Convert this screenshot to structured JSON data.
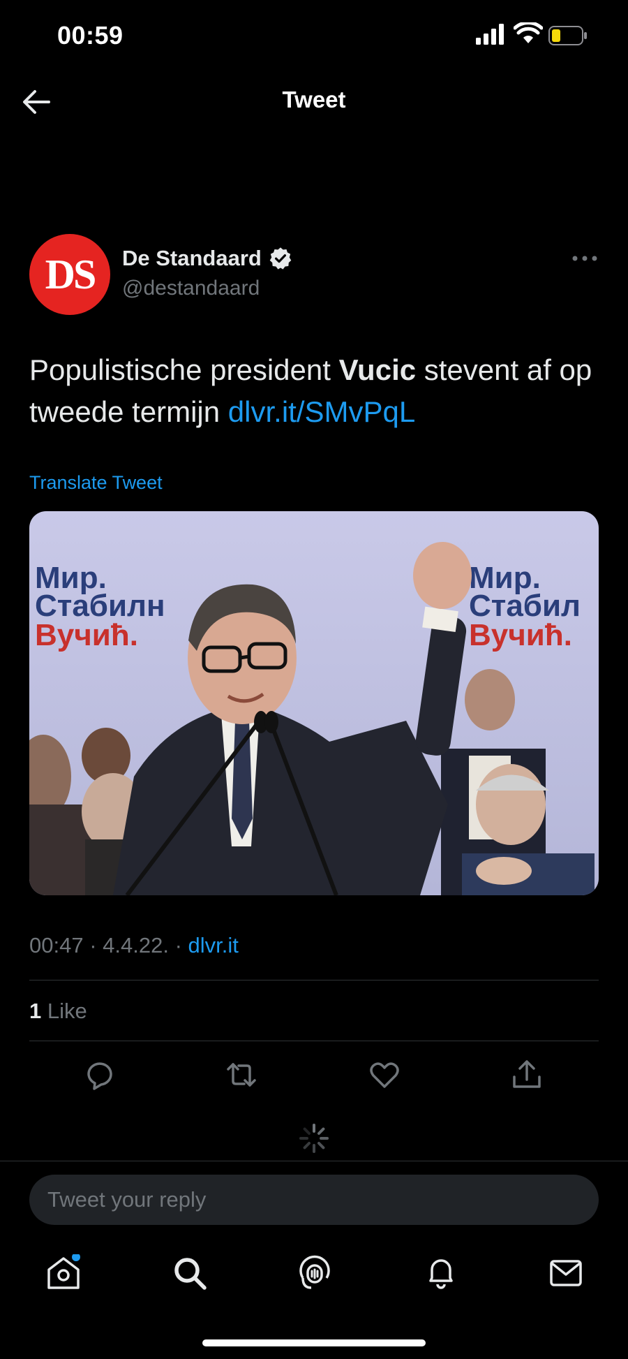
{
  "status_bar": {
    "time": "00:59"
  },
  "header": {
    "title": "Tweet"
  },
  "author": {
    "avatar_text": "DS",
    "name": "De Standaard",
    "handle": "@destandaard"
  },
  "tweet": {
    "text_before": "Populistische president ",
    "text_bold": "Vucic",
    "text_after": " stevent af op tweede termijn ",
    "link": "dlvr.it/SMvPqL",
    "translate": "Translate Tweet"
  },
  "photo": {
    "banner_lines": [
      "Мир.",
      "Стабилн",
      "Вучић."
    ],
    "banner_lines_right": [
      "Мир.",
      "Стабил",
      "Вучић."
    ]
  },
  "meta": {
    "time": "00:47",
    "date": "4.4.22.",
    "source": "dlvr.it",
    "sep": " · "
  },
  "engagement": {
    "likes_count": "1",
    "likes_label": " Like"
  },
  "reply": {
    "placeholder": "Tweet your reply"
  },
  "colors": {
    "accent": "#1d9bf0",
    "background": "#000000",
    "brand_red": "#e52421",
    "battery_yellow": "#f5d90a"
  },
  "icons": [
    "back-arrow-icon",
    "verified-badge-icon",
    "more-icon",
    "reply-icon",
    "retweet-icon",
    "like-icon",
    "share-icon",
    "spinner-icon",
    "home-icon",
    "search-icon",
    "spaces-icon",
    "notifications-icon",
    "messages-icon"
  ]
}
